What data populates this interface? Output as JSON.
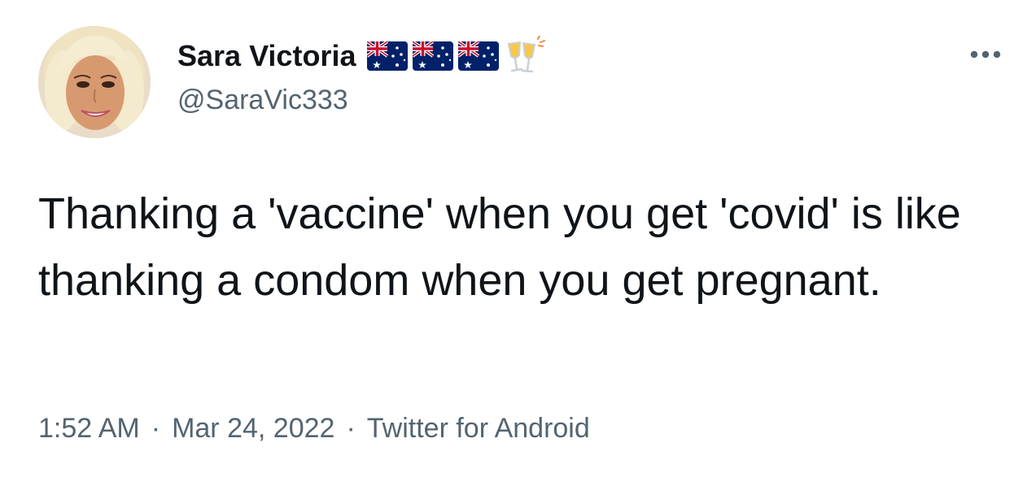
{
  "user": {
    "display_name": "Sara Victoria",
    "handle": "@SaraVic333",
    "name_emojis": [
      "australia-flag",
      "australia-flag",
      "australia-flag",
      "clinking-glasses"
    ]
  },
  "tweet": {
    "text": "Thanking a 'vaccine' when you get 'covid' is like thanking a condom when you get pregnant."
  },
  "meta": {
    "time": "1:52 AM",
    "separator": "·",
    "date": "Mar 24, 2022",
    "source": "Twitter for Android"
  },
  "icons": {
    "more": "more-horizontal-icon"
  },
  "colors": {
    "text_primary": "#0f1419",
    "text_secondary": "#536471",
    "background": "#ffffff"
  }
}
